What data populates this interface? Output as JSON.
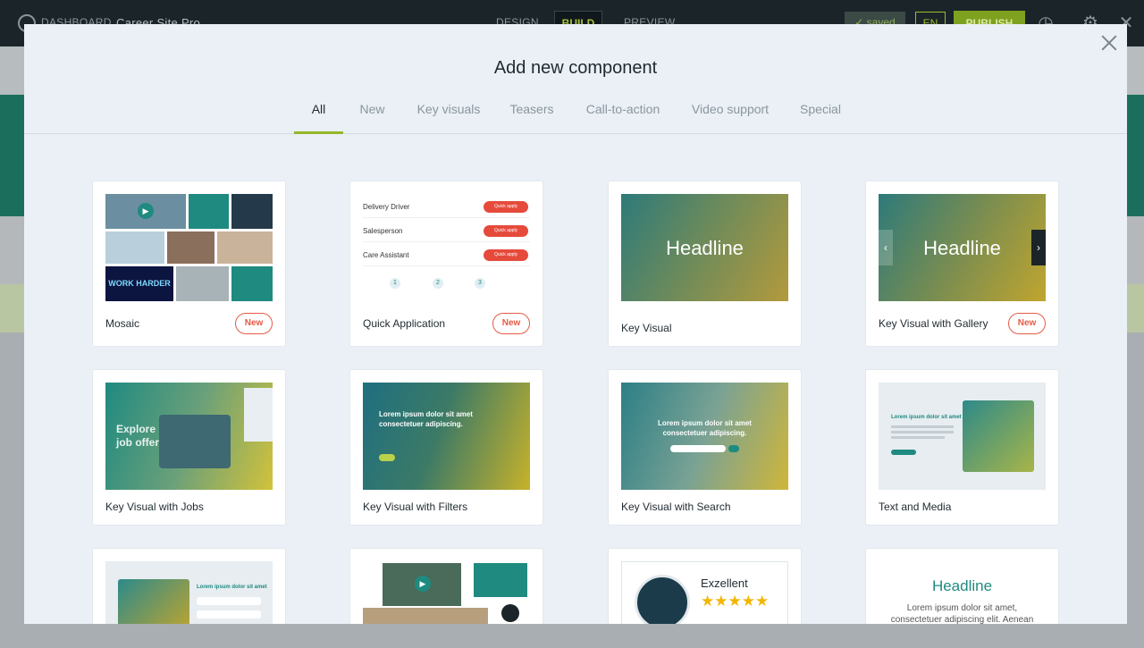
{
  "topbar": {
    "dashboard": "DASHBOARD",
    "site_name": "Career Site Pro",
    "design": "DESIGN",
    "build": "BUILD",
    "preview": "PREVIEW",
    "saved": "saved",
    "language": "EN",
    "publish": "PUBLISH"
  },
  "modal": {
    "title": "Add new component",
    "tabs": [
      "All",
      "New",
      "Key visuals",
      "Teasers",
      "Call-to-action",
      "Video support",
      "Special"
    ]
  },
  "cards": [
    {
      "label": "Mosaic",
      "badge": "New"
    },
    {
      "label": "Quick Application",
      "badge": "New"
    },
    {
      "label": "Key Visual"
    },
    {
      "label": "Key Visual with Gallery",
      "badge": "New"
    },
    {
      "label": "Key Visual with Jobs"
    },
    {
      "label": "Key Visual with Filters"
    },
    {
      "label": "Key Visual with Search"
    },
    {
      "label": "Text and Media"
    }
  ],
  "thumbs": {
    "mosaic_text": "WORK HARDER",
    "quick_app_jobs": [
      "Delivery Driver",
      "Salesperson",
      "Care Assistant"
    ],
    "quick_apply": "Quick apply",
    "steps": [
      "1",
      "2",
      "3"
    ],
    "headline": "Headline",
    "jobs_text": "Explore job offers",
    "filters_text": "Lorem ipsum dolor sit amet consectetuer adipiscing.",
    "search_text": "Lorem ipsum dolor sit amet consectetuer adipiscing.",
    "text_media": "Lorem ipsum dolor sit amet",
    "row3_text": "Lorem ipsum dolor sit amet",
    "excellent": "Exzellent",
    "stars": "★★★★★",
    "row3_headline": "Headline",
    "row3_body": "Lorem ipsum dolor sit amet, consectetuer adipiscing elit. Aenean"
  },
  "colors": {
    "accent": "#94b82a",
    "badge": "#e65a45",
    "teal": "#1f8a80"
  }
}
